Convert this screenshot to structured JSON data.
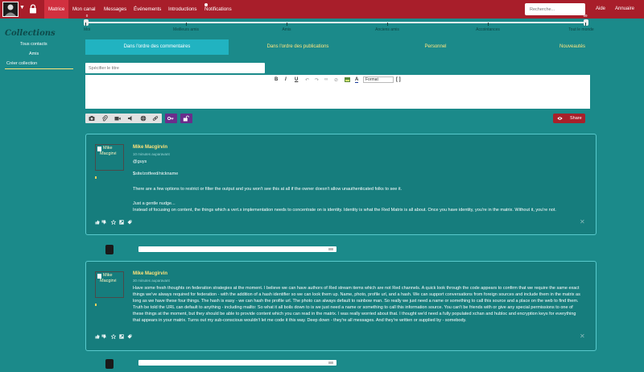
{
  "nav": {
    "items": [
      "Matrice",
      "Mon canal",
      "Messages",
      "Événements",
      "Introductions",
      "Notifications"
    ],
    "search_placeholder": "Recherche...",
    "right_items": [
      "Aide",
      "Annuaire"
    ]
  },
  "affinity": {
    "labels": [
      "Moi",
      "Meilleurs amis",
      "Amis",
      "Anciens amis",
      "Accointances",
      "Tout le monde"
    ],
    "low_value": "0",
    "high_value": "99"
  },
  "sidebar": {
    "title": "Collections",
    "items": [
      "Tous contacts",
      "Amis",
      "Créer collection"
    ]
  },
  "tabs": [
    "Dans l'ordre des commentaires",
    "Dans l'ordre des publications",
    "Personnel",
    "Nouveautés"
  ],
  "editor": {
    "title_placeholder": "Spécifier le titre",
    "format_label": "Format",
    "share_label": "Share"
  },
  "posts": [
    {
      "avatar_text": [
        "Mike",
        "Macgirvi"
      ],
      "author": "Mike Macgirvin",
      "time": "10 minutes auparavant",
      "lines": [
        "@guys",
        "$site/zotfeed/nickname",
        "There are a few options to restrict or filter the output and you won't see this at all if the owner doesn't allow unauthenticated folks to see it.",
        "Just a gentle nudge...",
        "Instead of focusing on content,  the things which a vert.x implementation needs to concentrate on is identity. Identity is what the Red Matrix is all about. Once you have identity, you're in the matrix. Without it, you're not."
      ]
    },
    {
      "avatar_text": [
        "Mike",
        "Macgirvi"
      ],
      "author": "Mike Macgirvin",
      "time": "30 minutes auparavant",
      "lines": [
        "Have some fresh thoughts on federation strategies at the moment. I believe we can have authors of Red stream items which are not Red channels. A quick look through the code appears to confirm that we require the same exact",
        "things we've always required for federation - with the addition of a hash identifier so we can look them up. Name, photo, profile url, and a hash. We can support conversations from foreign sources and include them in the matrix as",
        "long as we have these four things. The hash is easy - we can hash the profile url. The photo can always default to rainbow man. So really we just need a name or something to call this source and a place on the web to find them.",
        "Truth be told the URL can default to anything - including mailto: So what it all boils down to is we just need a name or something to call this information source. You can't be friends with or give any special permissions to one of",
        "these things at the moment, but they should be able to provide content which you can read in the matrix.  I was really worried about that. I thought we'd need a fully populated xchan and hubloc and encryption keys for everything",
        "that appears in your matrix. Turns out my sub-conscious wouldn't let me code it this way. Deep down - they're all messages. And they're written or supplied by - somebody."
      ]
    }
  ],
  "colors": {
    "page_bg": "#1b8a8a",
    "navbar": "#a81e2a",
    "active_nav": "#d1303f",
    "active_tab": "#21b3c1",
    "author": "#ffe37a",
    "share": "#a8202a",
    "acl_buttons": "#6a2d8c"
  },
  "icons": [
    "lock-icon",
    "camera-icon",
    "attach-icon",
    "video-icon",
    "audio-icon",
    "globe-icon",
    "link-icon",
    "key-icon",
    "unlock-icon",
    "eye-icon",
    "like-icon",
    "dislike-icon",
    "star-icon",
    "share-icon",
    "tag-icon",
    "close-icon",
    "doc-icon"
  ]
}
